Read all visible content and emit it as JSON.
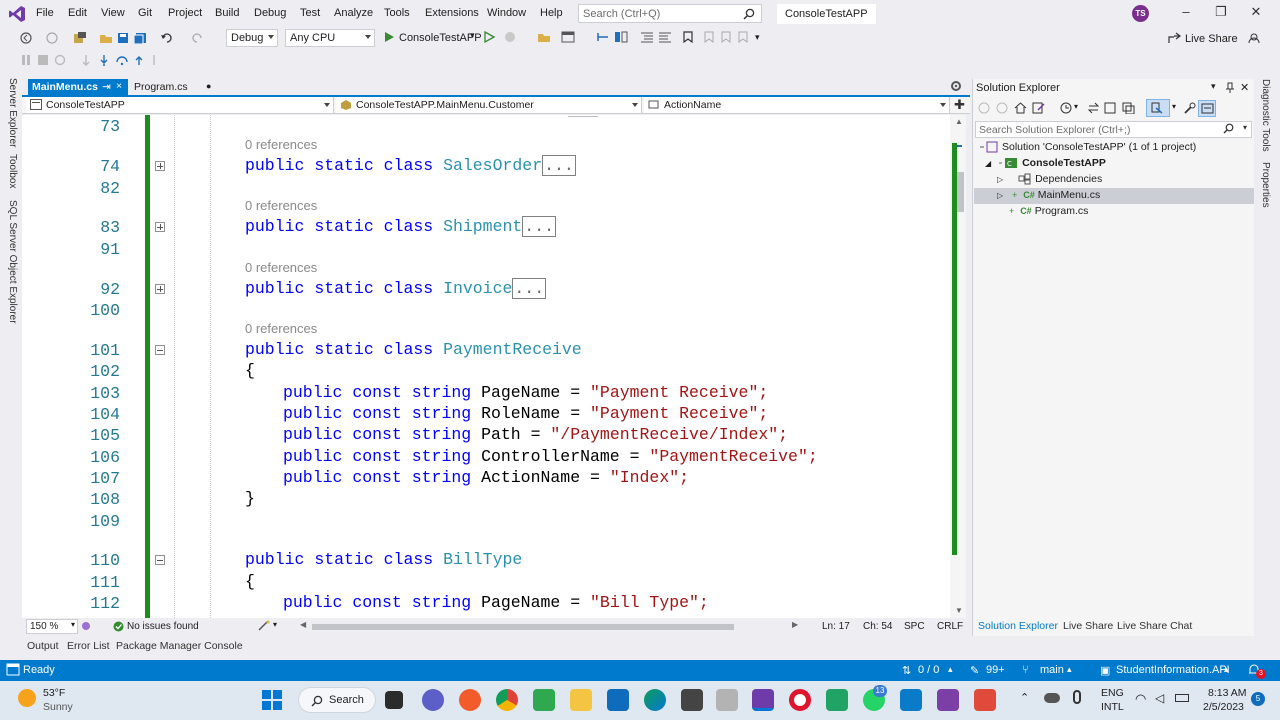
{
  "menu": {
    "items": [
      "File",
      "Edit",
      "View",
      "Git",
      "Project",
      "Build",
      "Debug",
      "Test",
      "Analyze",
      "Tools",
      "Extensions",
      "Window",
      "Help"
    ],
    "search_placeholder": "Search (Ctrl+Q)",
    "solution_name": "ConsoleTestAPP",
    "avatar_initials": "TS"
  },
  "toolbar": {
    "config": "Debug",
    "platform": "Any CPU",
    "run_target": "ConsoleTestAPP",
    "live_share": "Live Share"
  },
  "left_strip": [
    "Server Explorer",
    "Toolbox",
    "SQL Server Object Explorer"
  ],
  "right_strip": [
    "Diagnostic Tools",
    "Properties"
  ],
  "tabs": {
    "active": "MainMenu.cs",
    "active_pin": "⇥",
    "active_close": "×",
    "other": "Program.cs",
    "other_modified": "●"
  },
  "navbar": {
    "project": "ConsoleTestAPP",
    "type": "ConsoleTestAPP.MainMenu.Customer",
    "member": "ActionName"
  },
  "editor": {
    "lines": [
      {
        "n": "73"
      },
      {
        "n": "74"
      },
      {
        "n": "82"
      },
      {
        "n": "83"
      },
      {
        "n": "91"
      },
      {
        "n": "92"
      },
      {
        "n": "100"
      },
      {
        "n": "101"
      },
      {
        "n": "102"
      },
      {
        "n": "103"
      },
      {
        "n": "104"
      },
      {
        "n": "105"
      },
      {
        "n": "106"
      },
      {
        "n": "107"
      },
      {
        "n": "108"
      },
      {
        "n": "109"
      },
      {
        "n": "110"
      },
      {
        "n": "111"
      },
      {
        "n": "112"
      }
    ],
    "references": "0 references",
    "kw_public": "public",
    "kw_static": "static",
    "kw_class": "class",
    "kw_const": "const",
    "kw_string": "string",
    "collapsed_marker": "...",
    "classes": [
      "SalesOrder",
      "Shipment",
      "Invoice",
      "PaymentReceive",
      "BillType"
    ],
    "brace_open": "{",
    "brace_close": "}",
    "payment_members": [
      {
        "name": "PageName",
        "value": "\"Payment Receive\";"
      },
      {
        "name": "RoleName",
        "value": "\"Payment Receive\";"
      },
      {
        "name": "Path",
        "value": "\"/PaymentReceive/Index\";"
      },
      {
        "name": "ControllerName",
        "value": "\"PaymentReceive\";"
      },
      {
        "name": "ActionName",
        "value": "\"Index\";"
      }
    ],
    "billtype_member": {
      "name": "PageName",
      "value": "\"Bill Type\";"
    },
    "equals": "="
  },
  "editor_status": {
    "zoom": "150 %",
    "issues": "No issues found",
    "ln": "Ln: 17",
    "ch": "Ch: 54",
    "spc": "SPC",
    "crlf": "CRLF"
  },
  "solution_explorer": {
    "title": "Solution Explorer",
    "search_placeholder": "Search Solution Explorer (Ctrl+;)",
    "solution": "Solution 'ConsoleTestAPP' (1 of 1 project)",
    "project": "ConsoleTestAPP",
    "dependencies": "Dependencies",
    "file1": "MainMenu.cs",
    "file2": "Program.cs",
    "cs_badge": "C#",
    "tabs": [
      "Solution Explorer",
      "Live Share",
      "Live Share Chat"
    ]
  },
  "bottom_tabs": [
    "Output",
    "Error List",
    "Package Manager Console"
  ],
  "statusbar": {
    "ready": "Ready",
    "errors": "0 / 0",
    "changes": "99+",
    "branch": "main",
    "repo": "StudentInformation.API",
    "notifications": "3"
  },
  "taskbar": {
    "temp": "53°F",
    "weather": "Sunny",
    "search": "Search",
    "badge": "13",
    "lang1": "ENG",
    "lang2": "INTL",
    "time": "8:13 AM",
    "date": "2/5/2023",
    "notif": "5"
  },
  "colors": {
    "accent": "#007acc",
    "change_bar": "#1e8c1e",
    "keyword": "#0000ff",
    "type": "#2b91af",
    "string": "#a31515"
  }
}
